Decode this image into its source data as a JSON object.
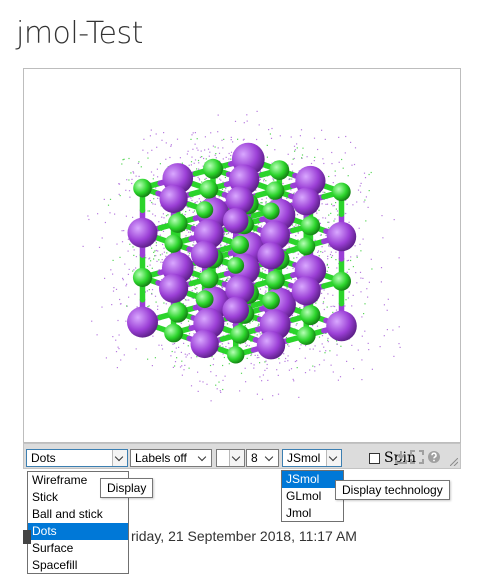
{
  "page": {
    "title": "jmol-Test"
  },
  "toolbar": {
    "style_select": "Dots",
    "labels_select": "Labels off",
    "blank_select": "",
    "number_select": "8",
    "tech_select": "JSmol",
    "spin_label": "Spin",
    "icons": [
      "download-icon",
      "fullscreen-icon",
      "help-icon"
    ]
  },
  "style_menu": {
    "options": [
      "Wireframe",
      "Stick",
      "Ball and stick",
      "Dots",
      "Surface",
      "Spacefill"
    ],
    "selected": "Dots"
  },
  "tech_menu": {
    "options": [
      "JSmol",
      "GLmol",
      "Jmol"
    ],
    "selected": "JSmol"
  },
  "tooltips": {
    "display": "Display",
    "display_technology": "Display technology"
  },
  "footer": {
    "date_text": "riday, 21 September 2018, 11:17 AM"
  },
  "colors": {
    "atom_purple": "#9b3fd6",
    "atom_green": "#2bd42b",
    "dots_purple": "#b77bdf",
    "dots_green": "#57d657",
    "selection_blue": "#0078d7"
  }
}
